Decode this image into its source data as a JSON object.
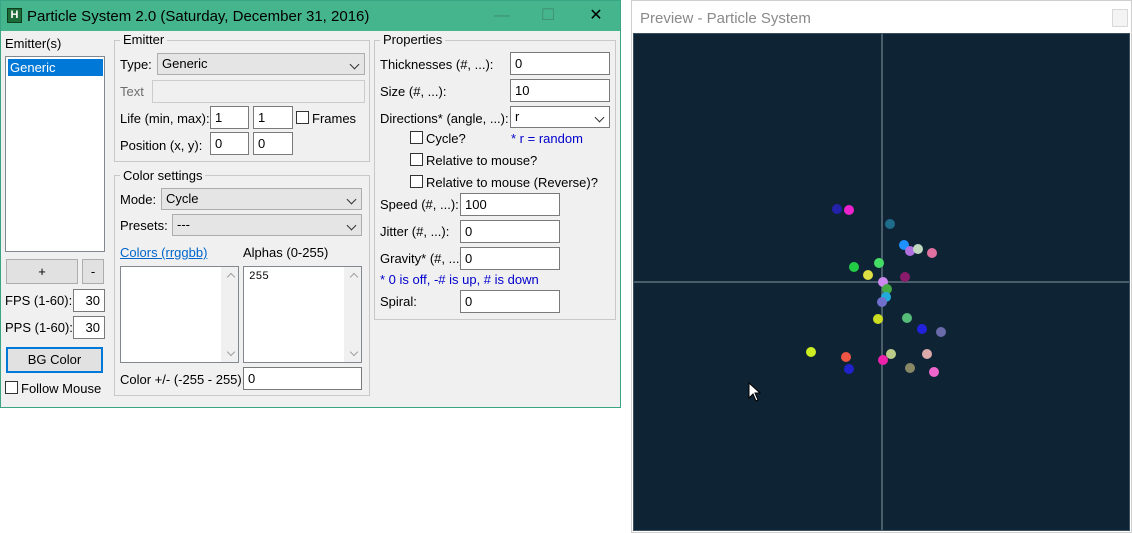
{
  "main_window": {
    "title": "Particle System 2.0 (Saturday, December 31, 2016)",
    "icon_letter": "H",
    "controls": {
      "minimize": "—",
      "maximize": "☐",
      "close": "✕"
    }
  },
  "emitters": {
    "label": "Emitter(s)",
    "items": [
      "Generic"
    ],
    "add_label": "+",
    "remove_label": "-",
    "fps_label": "FPS (1-60):",
    "fps_value": "30",
    "pps_label": "PPS (1-60):",
    "pps_value": "30",
    "bg_color_label": "BG Color",
    "follow_mouse_label": "Follow Mouse"
  },
  "emitter": {
    "title": "Emitter",
    "type_label": "Type:",
    "type_value": "Generic",
    "text_label": "Text",
    "text_value": "",
    "life_label": "Life (min, max):",
    "life_min": "1",
    "life_max": "1",
    "frames_label": "Frames",
    "position_label": "Position (x, y):",
    "position_x": "0",
    "position_y": "0"
  },
  "color_settings": {
    "title": "Color settings",
    "mode_label": "Mode:",
    "mode_value": "Cycle",
    "presets_label": "Presets:",
    "presets_value": "---",
    "colors_label": "Colors (rrggbb)",
    "colors_value": "",
    "alphas_label": "Alphas (0-255)",
    "alphas_value": "255",
    "color_pm_label": "Color +/- (-255 - 255):",
    "color_pm_value": "0"
  },
  "properties": {
    "title": "Properties",
    "thickness_label": "Thicknesses (#, ...):",
    "thickness_value": "0",
    "size_label": "Size (#, ...):",
    "size_value": "10",
    "directions_label": "Directions* (angle, ...):",
    "directions_value": "r",
    "cycle_label": "Cycle?",
    "random_note": "* r = random",
    "rel_mouse_label": "Relative to mouse?",
    "rel_mouse_rev_label": "Relative to mouse (Reverse)?",
    "speed_label": "Speed (#, ...):",
    "speed_value": "100",
    "jitter_label": "Jitter (#, ...):",
    "jitter_value": "0",
    "gravity_label": "Gravity* (#, ...):",
    "gravity_value": "0",
    "gravity_note": "* 0 is off, -# is up, # is down",
    "spiral_label": "Spiral:",
    "spiral_value": "0"
  },
  "preview": {
    "title": "Preview - Particle System",
    "bg_color": "#0e2435",
    "axis_color": "#4a5d6b",
    "particle_colors": [
      "#2222aa",
      "#ee22cc",
      "#1e6b8a",
      "#1e90ff",
      "#b070e0",
      "#c0d8c0",
      "#e070a0",
      "#22cc44",
      "#44dd66",
      "#dddd44",
      "#8a1a6a",
      "#cc88ee",
      "#44aa44",
      "#22aadd",
      "#7070cc",
      "#ccdd22",
      "#55bb77",
      "#2222dd",
      "#6a6aaa",
      "#ddaaaa",
      "#ccee22",
      "#ee5544",
      "#ee22aa",
      "#bbcc88",
      "#2222cc",
      "#888866",
      "#ee66cc"
    ]
  }
}
